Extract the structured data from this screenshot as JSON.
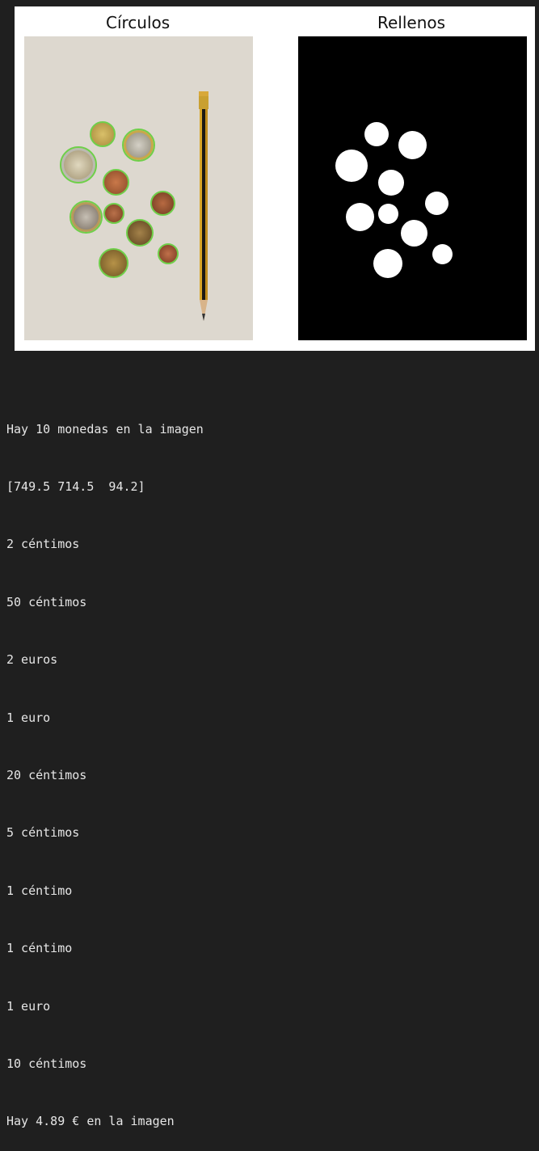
{
  "figure": {
    "left_title": "Círculos",
    "right_title": "Rellenos"
  },
  "output": {
    "lines": [
      "Hay 10 monedas en la imagen",
      "[749.5 714.5  94.2]",
      "2 céntimos",
      "50 céntimos",
      "2 euros",
      "1 euro",
      "20 céntimos",
      "5 céntimos",
      "1 céntimo",
      "1 céntimo",
      "1 euro",
      "10 céntimos",
      "Hay 4.89 € en la imagen"
    ]
  },
  "colors": {
    "background": "#1f1f1f",
    "circle_outline": "#6fcf4a"
  }
}
